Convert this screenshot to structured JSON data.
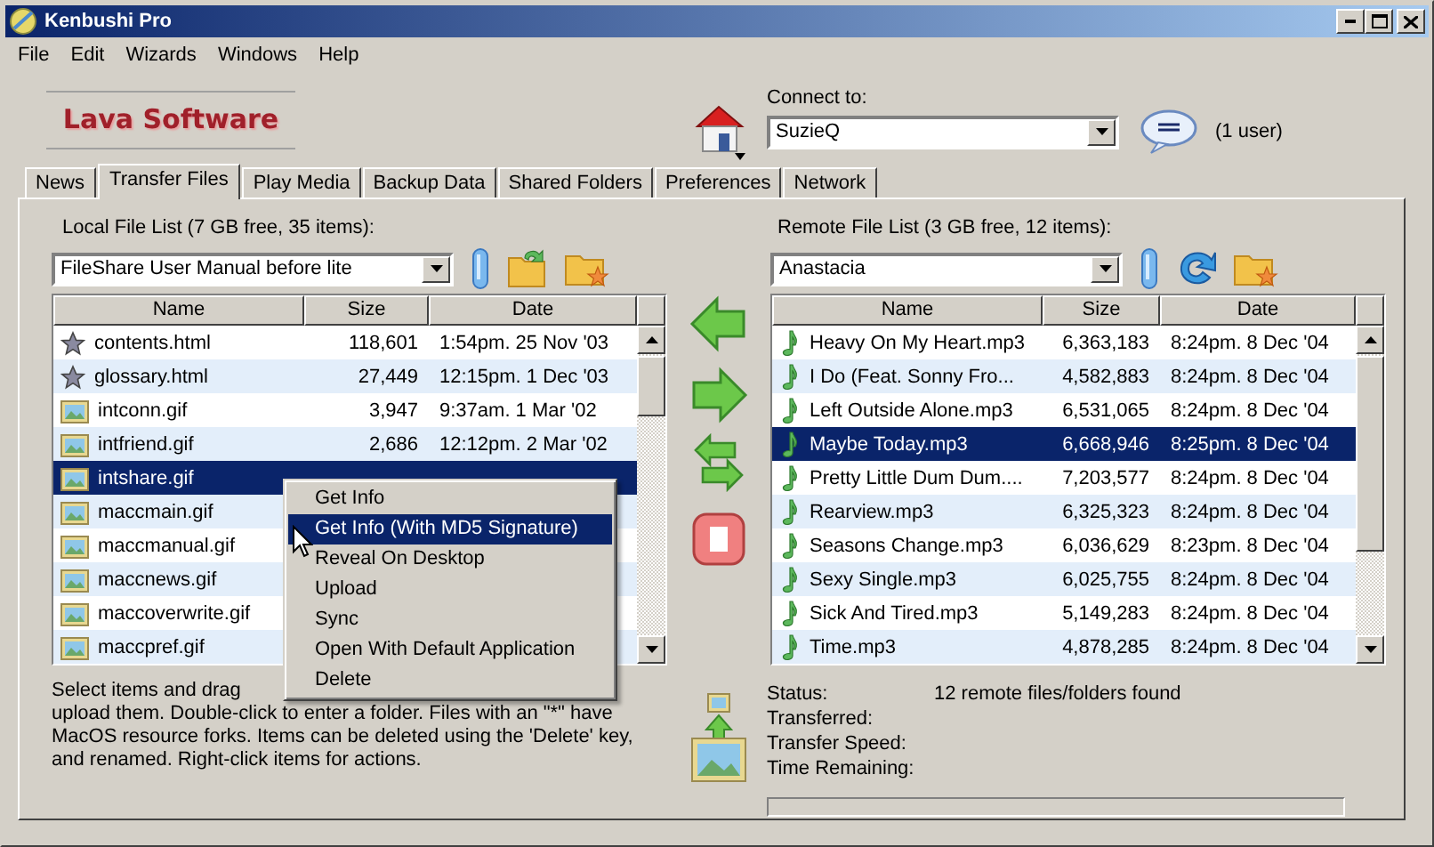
{
  "window": {
    "title": "Kenbushi Pro"
  },
  "menu_bar": [
    "File",
    "Edit",
    "Wizards",
    "Windows",
    "Help"
  ],
  "logo": "Lava Software",
  "connect": {
    "label": "Connect to:",
    "value": "SuzieQ",
    "users": "(1 user)"
  },
  "tabs": [
    {
      "label": "News",
      "selected": false
    },
    {
      "label": "Transfer Files",
      "selected": true
    },
    {
      "label": "Play Media",
      "selected": false
    },
    {
      "label": "Backup Data",
      "selected": false
    },
    {
      "label": "Shared Folders",
      "selected": false
    },
    {
      "label": "Preferences",
      "selected": false
    },
    {
      "label": "Network",
      "selected": false
    }
  ],
  "local": {
    "label": "Local File List (7 GB free, 35 items):",
    "folder": "FileShare User Manual before lite",
    "columns": [
      "Name",
      "Size",
      "Date"
    ],
    "rows": [
      {
        "kind": "web",
        "name": "contents.html",
        "size": "118,601",
        "date": "1:54pm. 25 Nov '03",
        "selected": false
      },
      {
        "kind": "web",
        "name": "glossary.html",
        "size": "27,449",
        "date": "12:15pm. 1 Dec '03",
        "selected": false
      },
      {
        "kind": "image",
        "name": "intconn.gif",
        "size": "3,947",
        "date": "9:37am. 1 Mar '02",
        "selected": false
      },
      {
        "kind": "image",
        "name": "intfriend.gif",
        "size": "2,686",
        "date": "12:12pm. 2 Mar '02",
        "selected": false
      },
      {
        "kind": "image",
        "name": "intshare.gif",
        "selected": true
      },
      {
        "kind": "image",
        "name": "maccmain.gif",
        "selected": false
      },
      {
        "kind": "image",
        "name": "maccmanual.gif",
        "selected": false
      },
      {
        "kind": "image",
        "name": "maccnews.gif",
        "selected": false
      },
      {
        "kind": "image",
        "name": "maccoverwrite.gif",
        "selected": false
      },
      {
        "kind": "image",
        "name": "maccpref.gif",
        "selected": false
      }
    ]
  },
  "remote": {
    "label": "Remote File List (3 GB free, 12 items):",
    "folder": "Anastacia",
    "columns": [
      "Name",
      "Size",
      "Date"
    ],
    "rows": [
      {
        "kind": "audio",
        "name": "Heavy On My Heart.mp3",
        "size": "6,363,183",
        "date": "8:24pm. 8 Dec '04",
        "selected": false
      },
      {
        "kind": "audio",
        "name": "I Do (Feat. Sonny Fro...",
        "size": "4,582,883",
        "date": "8:24pm. 8 Dec '04",
        "selected": false
      },
      {
        "kind": "audio",
        "name": "Left Outside Alone.mp3",
        "size": "6,531,065",
        "date": "8:24pm. 8 Dec '04",
        "selected": false
      },
      {
        "kind": "audio",
        "name": "Maybe Today.mp3",
        "size": "6,668,946",
        "date": "8:25pm. 8 Dec '04",
        "selected": true
      },
      {
        "kind": "audio",
        "name": "Pretty Little Dum Dum....",
        "size": "7,203,577",
        "date": "8:24pm. 8 Dec '04",
        "selected": false
      },
      {
        "kind": "audio",
        "name": "Rearview.mp3",
        "size": "6,325,323",
        "date": "8:24pm. 8 Dec '04",
        "selected": false
      },
      {
        "kind": "audio",
        "name": "Seasons Change.mp3",
        "size": "6,036,629",
        "date": "8:23pm. 8 Dec '04",
        "selected": false
      },
      {
        "kind": "audio",
        "name": "Sexy Single.mp3",
        "size": "6,025,755",
        "date": "8:24pm. 8 Dec '04",
        "selected": false
      },
      {
        "kind": "audio",
        "name": "Sick And Tired.mp3",
        "size": "5,149,283",
        "date": "8:24pm. 8 Dec '04",
        "selected": false
      },
      {
        "kind": "audio",
        "name": "Time.mp3",
        "size": "4,878,285",
        "date": "8:24pm. 8 Dec '04",
        "selected": false
      }
    ]
  },
  "help_text": [
    "Select items and drag",
    "upload them. Double-click to enter a folder. Files with an \"*\" have",
    "MacOS resource forks. Items can be deleted using the 'Delete' key,",
    "and renamed. Right-click items for actions."
  ],
  "status": [
    {
      "label": "Status:",
      "value": "12 remote files/folders found"
    },
    {
      "label": "Transferred:"
    },
    {
      "label": "Transfer Speed:"
    },
    {
      "label": "Time Remaining:"
    }
  ],
  "progress": {
    "level": 0
  },
  "context_menu": [
    {
      "label": "Get Info",
      "selected": false
    },
    {
      "label": "Get Info (With MD5 Signature)",
      "selected": true
    },
    {
      "label": "Reveal On Desktop",
      "selected": false
    },
    {
      "label": "Upload",
      "selected": false
    },
    {
      "label": "Sync",
      "selected": false
    },
    {
      "label": "Open With Default Application",
      "selected": false
    },
    {
      "label": "Delete",
      "selected": false
    }
  ]
}
